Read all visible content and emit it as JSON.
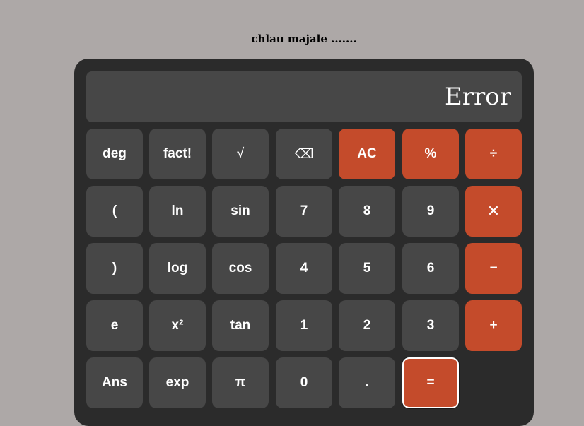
{
  "page": {
    "heading": "chlau majale ......."
  },
  "display": {
    "value": "Error"
  },
  "keys": {
    "deg": "deg",
    "fact": "fact!",
    "sqrt": "√",
    "backspace": "⌫",
    "ac": "AC",
    "percent": "%",
    "divide": "÷",
    "lparen": "(",
    "ln": "ln",
    "sin": "sin",
    "seven": "7",
    "eight": "8",
    "nine": "9",
    "multiply": "✕",
    "rparen": ")",
    "log": "log",
    "cos": "cos",
    "four": "4",
    "five": "5",
    "six": "6",
    "minus": "−",
    "e": "e",
    "square": "x²",
    "tan": "tan",
    "one": "1",
    "two": "2",
    "three": "3",
    "plus": "+",
    "ans": "Ans",
    "exp": "exp",
    "pi": "π",
    "zero": "0",
    "dot": ".",
    "equals": "="
  },
  "colors": {
    "background": "#ada8a7",
    "body": "#2b2b2b",
    "key": "#474747",
    "accent": "#c44b2b",
    "text": "#ffffff"
  }
}
